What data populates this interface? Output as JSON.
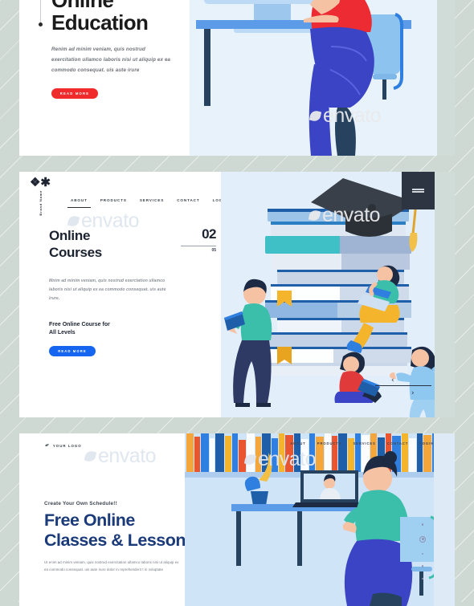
{
  "page": {
    "background_color": "#cfd9d4",
    "watermark_text": "envato"
  },
  "panel1": {
    "title_line1": "Online",
    "title_line2": "Education",
    "paragraph": "Renim ad minim veniam, quis nostrud exercitation ullamco laboris nisi ut aliquip ex ea commodo consequat. uis aute irure",
    "cta_label": "READ MORE",
    "cta_color": "#ef2b2b",
    "illustration": "woman-with-headset-video-call-at-desk"
  },
  "panel2": {
    "brand_icon": "asterisk-star-icon",
    "brand_name": "Brand Name",
    "nav": [
      {
        "label": "ABOUT",
        "active": true
      },
      {
        "label": "PRODUCTS",
        "active": false
      },
      {
        "label": "SERVICES",
        "active": false
      },
      {
        "label": "CONTACT",
        "active": false
      },
      {
        "label": "LOGIN",
        "active": false
      }
    ],
    "title_line1": "Online",
    "title_line2": "Courses",
    "paragraph": "Mnim ad minim veniam, quis nostrud exerctation ullamco laboris nisi ut aliquip ex ea commodo consequat. uis aute irure.",
    "kicker_line1": "Free Online Course for",
    "kicker_line2": "All Levels",
    "cta_label": "READ MORE",
    "cta_color": "#1565f0",
    "slide_current": "02",
    "slide_total": "05",
    "menu_icon": "hamburger-icon",
    "prev_icon": "chevron-left-icon",
    "next_icon": "chevron-right-icon",
    "illustration": "stack-of-books-graduation-cap-students-reading"
  },
  "panel3": {
    "logo_icon": "pen-nib-icon",
    "logo_text": "YOUR LOGO",
    "nav": [
      {
        "label": "ABOUT"
      },
      {
        "label": "PRODUCTS"
      },
      {
        "label": "SERVICES"
      },
      {
        "label": "CONTACT"
      },
      {
        "label": "LOGIN"
      }
    ],
    "kicker": "Create Your Own Schedule!!",
    "title_line1": "Free Online",
    "title_line2": "Classes & Lessons",
    "title_color": "#1a3a7a",
    "paragraph": "Ut enim ad minim veniam, quis nostrud exercitation ullamco laboris nisi ut aliquip ex ea commodo consequat. uis aute irure dolor in reprehenderit t in voluptate",
    "pagination_dots": 5,
    "pagination_active_index": 1,
    "illustration": "student-at-laptop-in-front-of-bookshelf"
  }
}
